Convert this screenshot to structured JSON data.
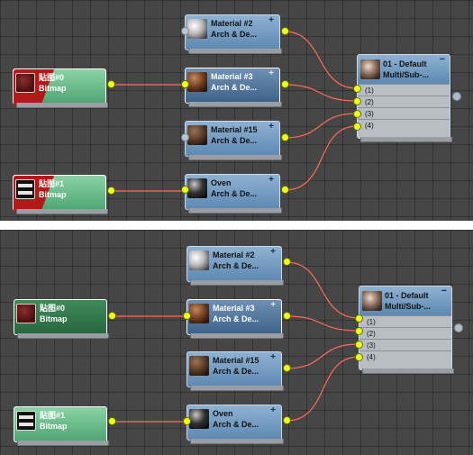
{
  "top": {
    "nodes": {
      "mat2": {
        "name": "Material #2",
        "type": "Arch & De..."
      },
      "mat3": {
        "name": "Material #3",
        "type": "Arch & De..."
      },
      "mat15": {
        "name": "Material #15",
        "type": "Arch & De..."
      },
      "oven": {
        "name": "Oven",
        "type": "Arch & De..."
      },
      "bitmap0": {
        "name": "貼图#0",
        "type": "Bitmap"
      },
      "bitmap1": {
        "name": "貼图#1",
        "type": "Bitmap"
      },
      "multi": {
        "name": "01 - Default",
        "type": "Multi/Sub-...",
        "slots": [
          "(1)",
          "(2)",
          "(3)",
          "(4)"
        ]
      }
    }
  },
  "bottom": {
    "nodes": {
      "mat2": {
        "name": "Material #2",
        "type": "Arch & De..."
      },
      "mat3": {
        "name": "Material #3",
        "type": "Arch & De..."
      },
      "mat15": {
        "name": "Material #15",
        "type": "Arch & De..."
      },
      "oven": {
        "name": "Oven",
        "type": "Arch & De..."
      },
      "bitmap0": {
        "name": "貼图#0",
        "type": "Bitmap"
      },
      "bitmap1": {
        "name": "貼图#1",
        "type": "Bitmap"
      },
      "multi": {
        "name": "01 - Default",
        "type": "Multi/Sub-...",
        "slots": [
          "(1)",
          "(2)",
          "(3)",
          "(4)"
        ]
      }
    }
  },
  "colors": {
    "wire": "#ff6a5a",
    "port": "#e9ff1f",
    "material_node": "#6f97c0",
    "bitmap_node": "#5fb382"
  },
  "icons": {
    "expand": "plus-icon",
    "collapse": "minus-icon"
  },
  "glyphs": {
    "plus": "+",
    "minus": "−"
  }
}
